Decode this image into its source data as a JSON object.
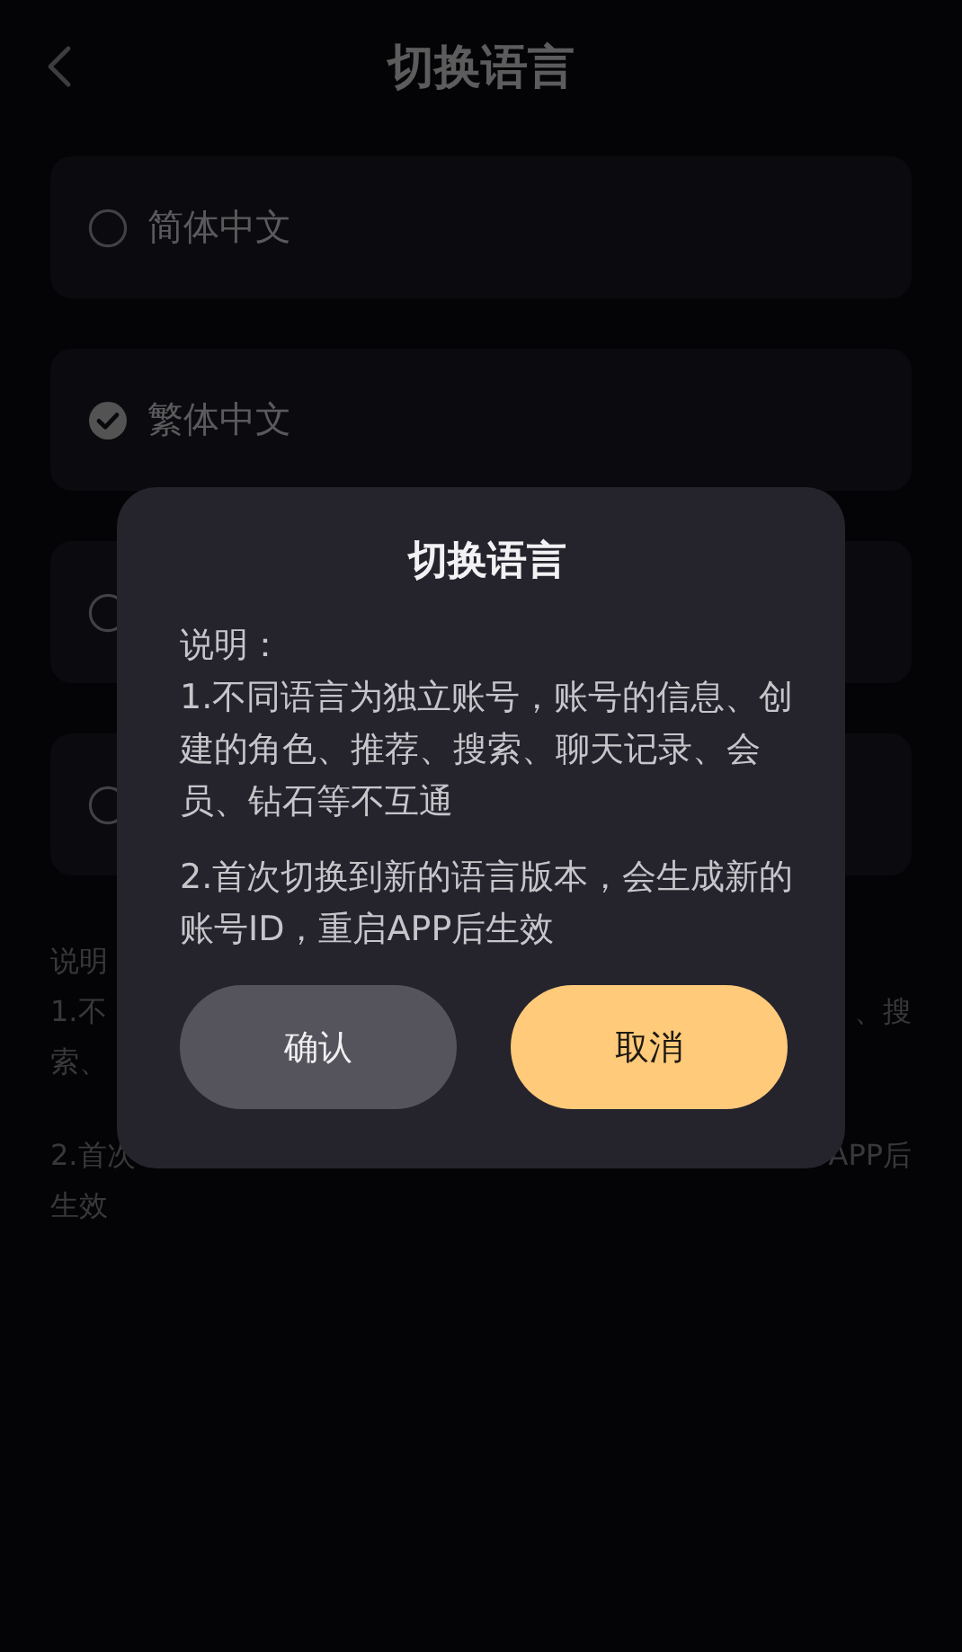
{
  "header": {
    "title": "切换语言"
  },
  "languages": [
    {
      "label": "简体中文",
      "selected": false
    },
    {
      "label": "繁体中文",
      "selected": true
    },
    {
      "selected": false
    },
    {
      "selected": false
    }
  ],
  "notes": [
    {
      "lines": [
        {
          "left": "说明"
        },
        {
          "left": "1.不",
          "right": "、搜"
        },
        {
          "left": "索、"
        }
      ]
    },
    {
      "lines": [
        {
          "left": "2.首次",
          "right": "APP后"
        },
        {
          "left": "生效"
        }
      ]
    }
  ],
  "dialog": {
    "title": "切换语言",
    "heading": "说明：",
    "paragraphs": [
      "1.不同语言为独立账号，账号的信息、创建的角色、推荐、搜索、聊天记录、会员、钻石等不互通",
      "2.首次切换到新的语言版本，会生成新的账号ID，重启APP后生效"
    ],
    "buttons": [
      {
        "label": "确认",
        "kind": "secondary"
      },
      {
        "label": "取消",
        "kind": "primary"
      }
    ]
  }
}
